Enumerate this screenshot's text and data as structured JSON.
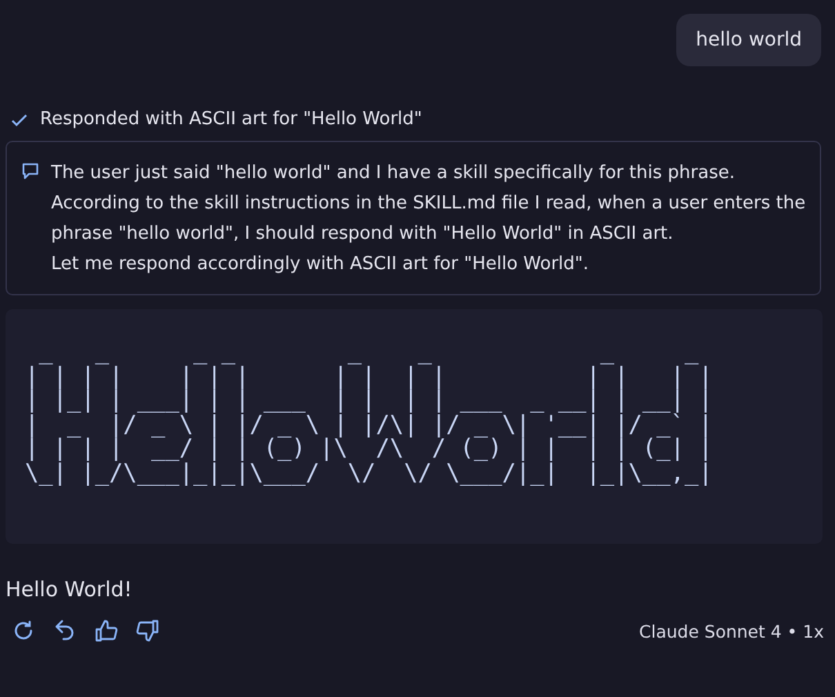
{
  "user_message": {
    "text": "hello world"
  },
  "status": {
    "text": "Responded with ASCII art for \"Hello World\""
  },
  "thinking": {
    "lines": [
      "The user just said \"hello world\" and I have a skill specifically for this phrase.",
      "According to the skill instructions in the SKILL.md file I read, when a user enters the",
      "phrase \"hello world\", I should respond with \"Hello World\" in ASCII art.",
      "Let me respond accordingly with ASCII art for \"Hello World\"."
    ]
  },
  "ascii_art": {
    "lines": [
      " _   _      _ _        _    _            _     _ ",
      "| | | |    | | |      | |  | |          | |   | |",
      "| |_| | ___| | | ___  | |  | | ___  _ __| | __| |",
      "|  _  |/ _ \\ | |/ _ \\ | |/\\| |/ _ \\| '__| |/ _` |",
      "| | | |  __/ | | (_) |\\  /\\  / (_) | |  | | (_| |",
      "\\_| |_/\\___|_|_|\\___/  \\/  \\/ \\___/|_|  |_|\\__,_|"
    ]
  },
  "reply": {
    "text": "Hello World!"
  },
  "actions": [
    {
      "kind": "retry"
    },
    {
      "kind": "undo"
    },
    {
      "kind": "like"
    },
    {
      "kind": "dislike"
    }
  ],
  "model_label": "Claude Sonnet 4 • 1x"
}
